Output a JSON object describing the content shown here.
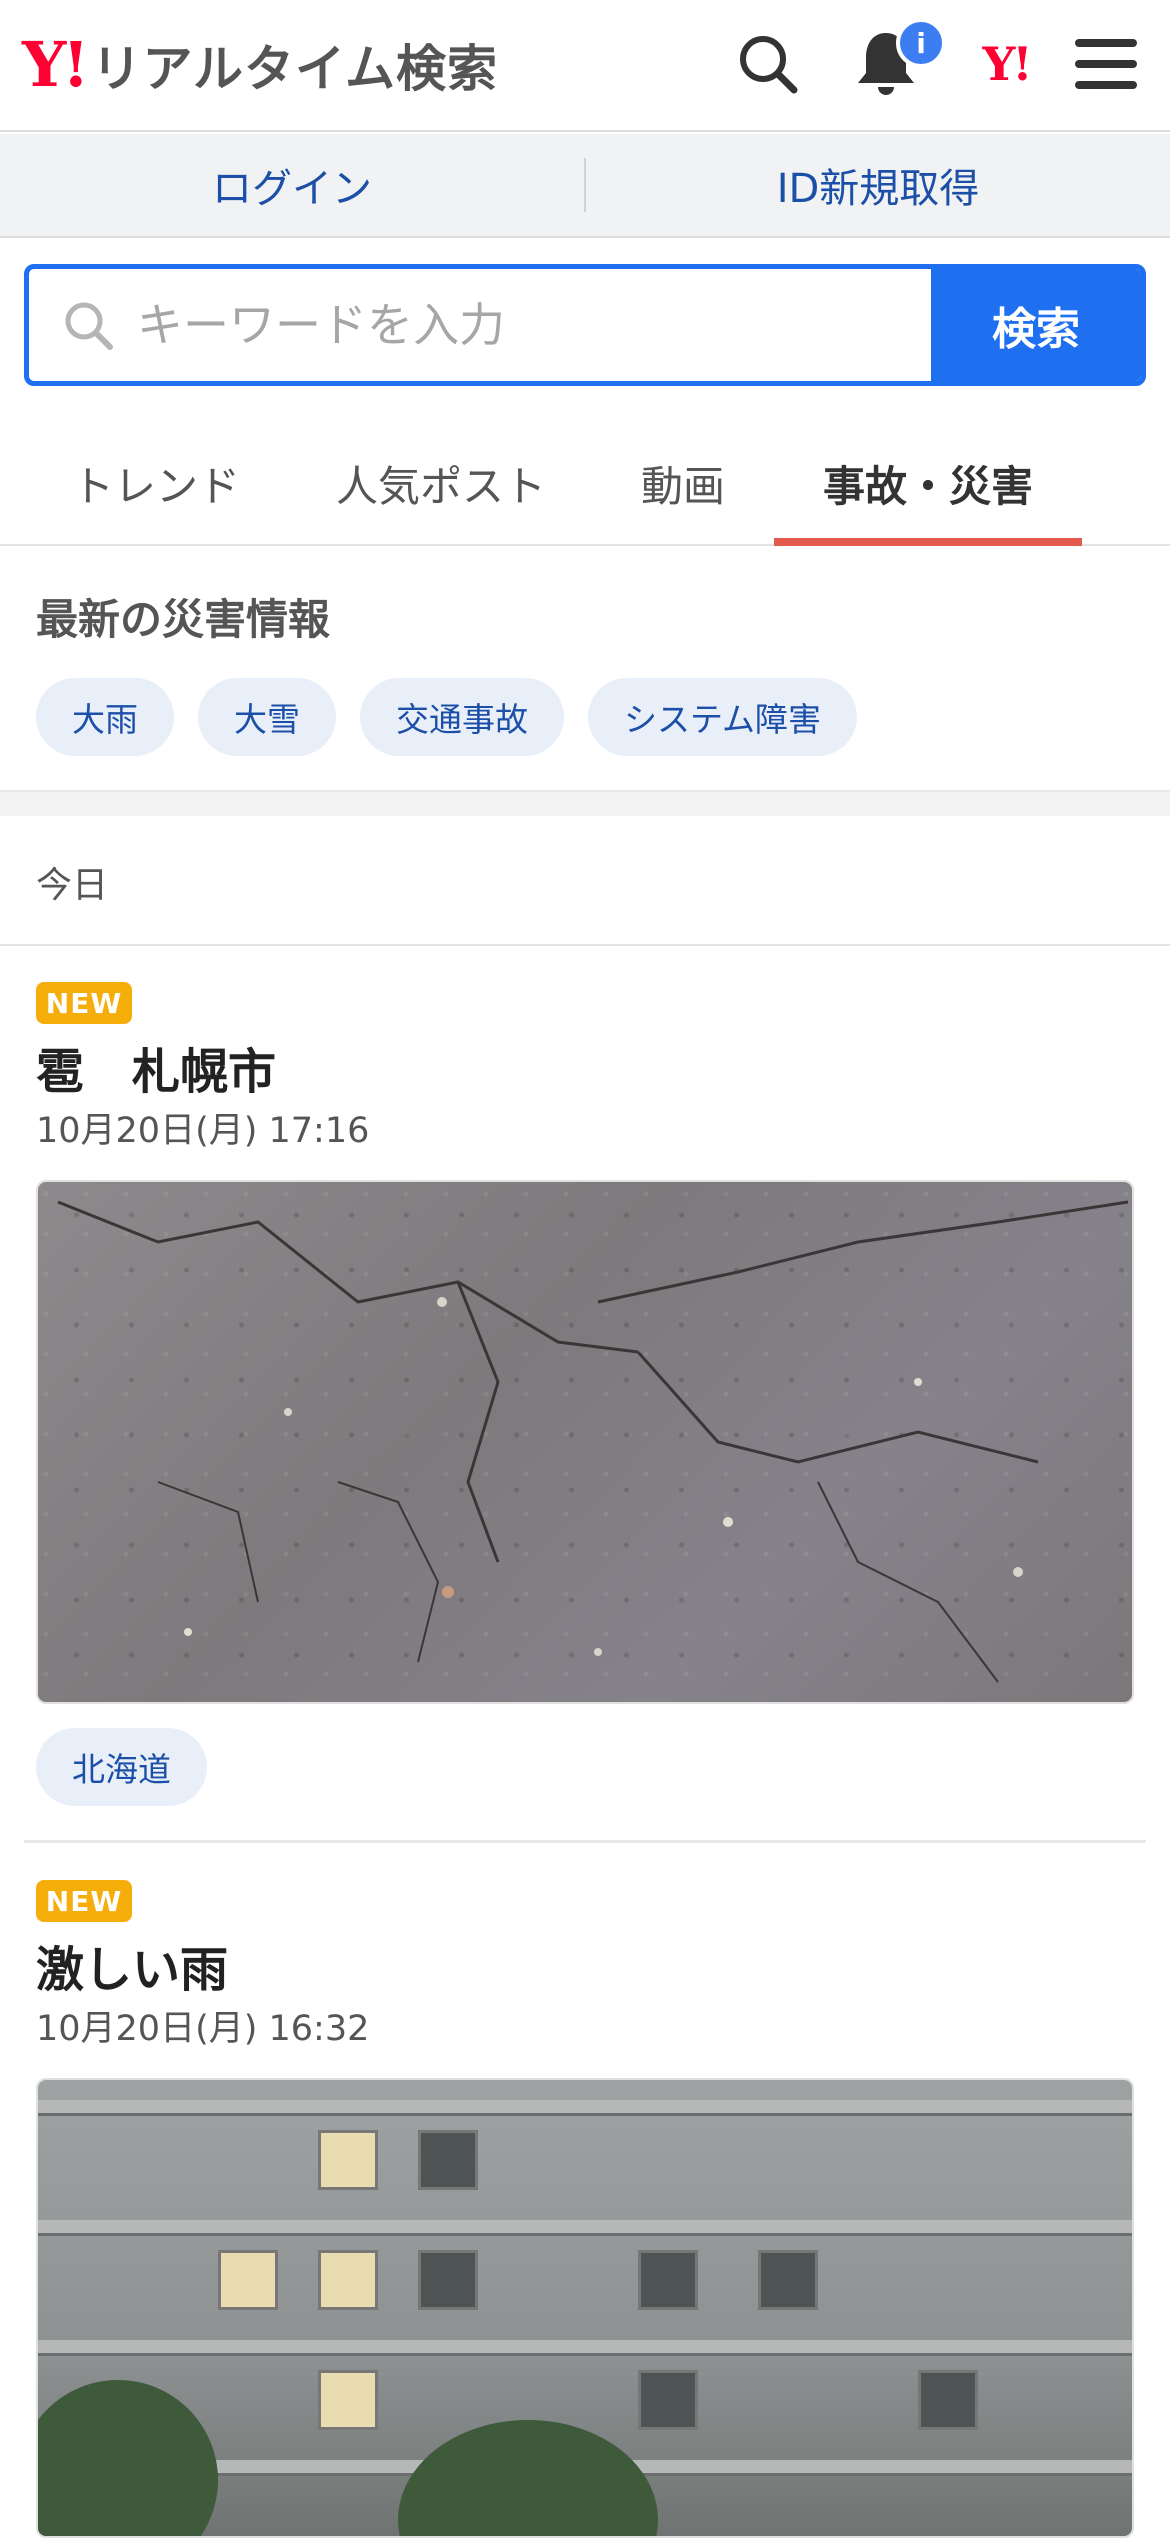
{
  "header": {
    "logo_y": "Y!",
    "logo_text": "リアルタイム検索",
    "notification_badge": "i",
    "yahoo_mark": "Y!"
  },
  "account": {
    "login": "ログイン",
    "register": "ID新規取得"
  },
  "search": {
    "placeholder": "キーワードを入力",
    "button": "検索"
  },
  "tabs": [
    {
      "label": "トレンド",
      "active": false
    },
    {
      "label": "人気ポスト",
      "active": false
    },
    {
      "label": "動画",
      "active": false
    },
    {
      "label": "事故・災害",
      "active": true
    }
  ],
  "disaster_info": {
    "title": "最新の災害情報",
    "chips": [
      "大雨",
      "大雪",
      "交通事故",
      "システム障害"
    ]
  },
  "feed": {
    "day_label": "今日",
    "posts": [
      {
        "badge": "NEW",
        "title": "雹　札幌市",
        "time": "10月20日(月) 17:16",
        "region": "北海道"
      },
      {
        "badge": "NEW",
        "title": "激しい雨",
        "time": "10月20日(月) 16:32"
      }
    ]
  },
  "colors": {
    "brand_red": "#ff0033",
    "accent_blue": "#1f70f1",
    "link_blue": "#1c4fa8",
    "tab_underline": "#e35a4f",
    "new_badge": "#f5ad0a",
    "chip_bg": "#e8eff9"
  }
}
